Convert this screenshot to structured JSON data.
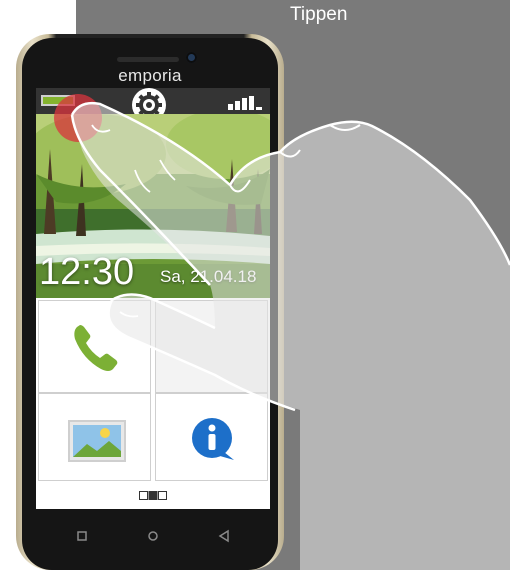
{
  "hint": {
    "text": "Tippen"
  },
  "device": {
    "brand": "emporia"
  },
  "status": {
    "battery_color": "#84b32f"
  },
  "home": {
    "time": "12:30",
    "date": "Sa, 21.04.18"
  },
  "tiles": [
    {
      "icon": "phone-icon"
    },
    {
      "icon": "empty"
    },
    {
      "icon": "gallery-icon"
    },
    {
      "icon": "info-icon"
    }
  ],
  "pager": {
    "pages": 3,
    "active": 2
  },
  "colors": {
    "panel": "#7a7a7a",
    "accent_green": "#84b32f",
    "info_blue": "#1d6fc9"
  }
}
